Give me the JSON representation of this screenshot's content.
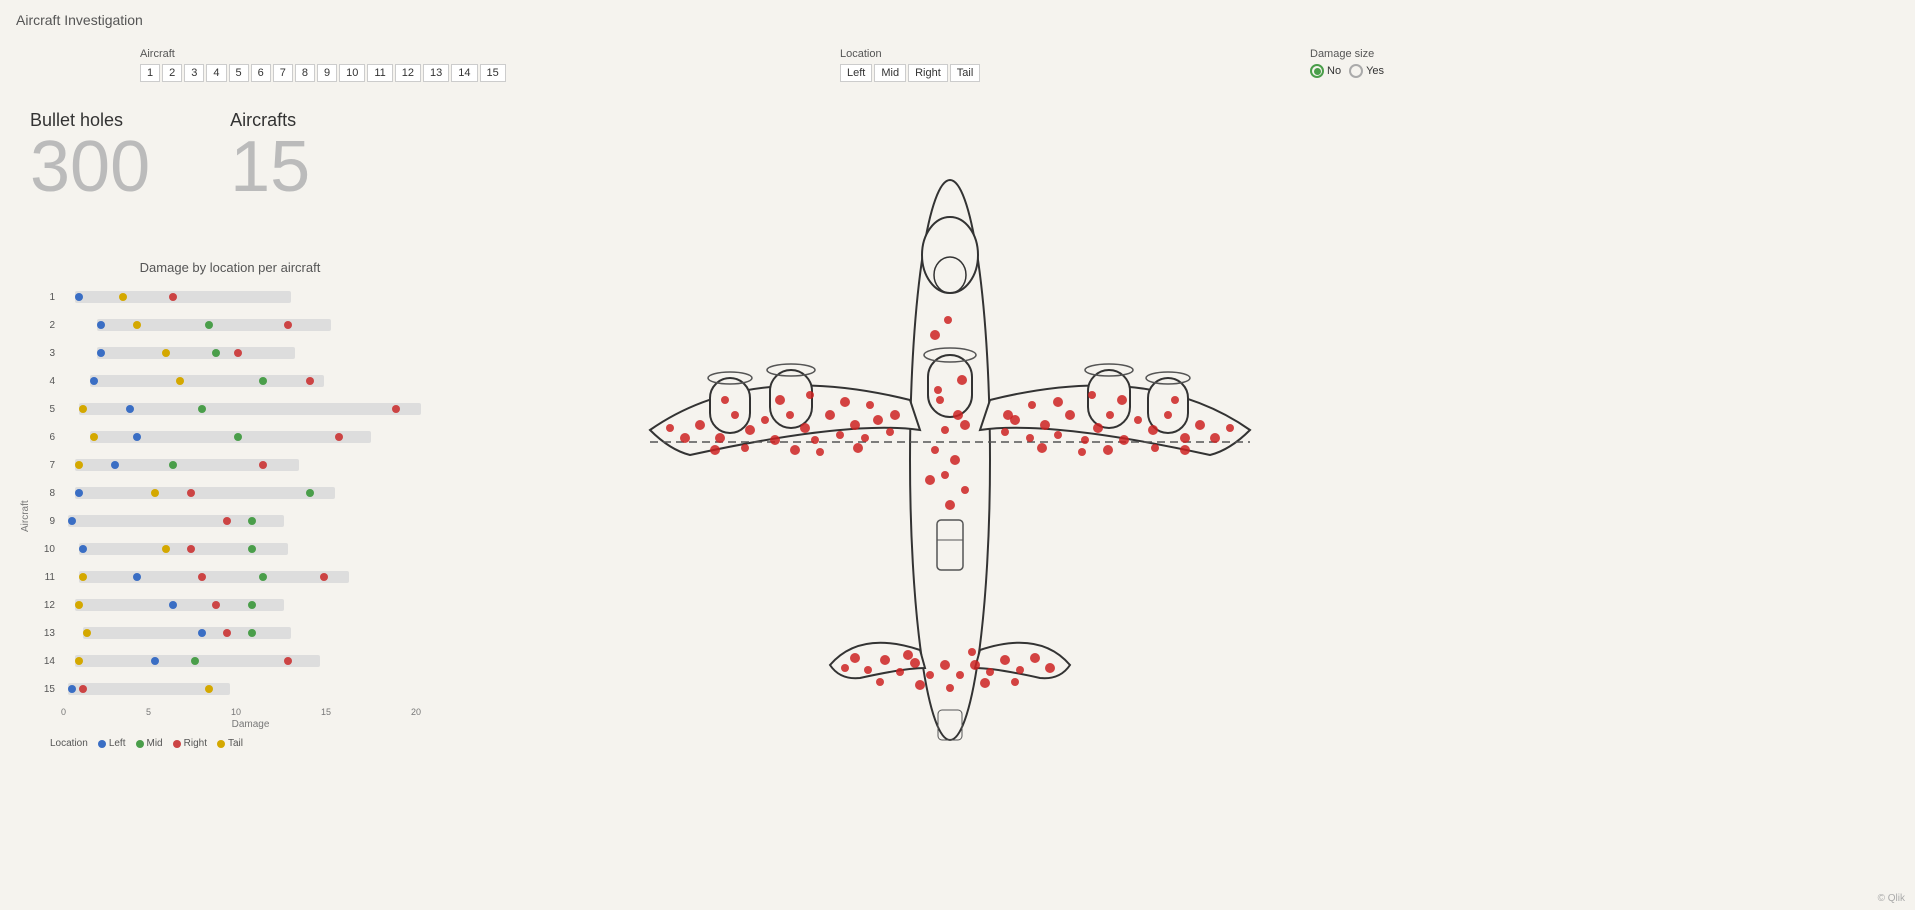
{
  "app": {
    "title": "Aircraft Investigation"
  },
  "aircraft_filter": {
    "label": "Aircraft",
    "buttons": [
      "1",
      "2",
      "3",
      "4",
      "5",
      "6",
      "7",
      "8",
      "9",
      "10",
      "11",
      "12",
      "13",
      "14",
      "15"
    ]
  },
  "location_filter": {
    "label": "Location",
    "buttons": [
      "Left",
      "Mid",
      "Right",
      "Tail"
    ]
  },
  "damage_size_filter": {
    "label": "Damage size",
    "options": [
      {
        "label": "No",
        "selected": true
      },
      {
        "label": "Yes",
        "selected": false
      }
    ]
  },
  "kpis": {
    "bullet_holes": {
      "label": "Bullet holes",
      "value": "300"
    },
    "aircrafts": {
      "label": "Aircrafts",
      "value": "15"
    }
  },
  "chart": {
    "title": "Damage by location per aircraft",
    "y_axis_label": "Aircraft",
    "x_axis_label": "Damage",
    "x_ticks": [
      "0",
      "5",
      "10",
      "15",
      "20"
    ],
    "rows": [
      {
        "id": "1",
        "bars": [
          {
            "left_pct": 4,
            "width_pct": 60
          }
        ],
        "dots": [
          {
            "color": "#3a6ec4",
            "pct": 4
          },
          {
            "color": "#d4a800",
            "pct": 16
          },
          {
            "color": "#cc4444",
            "pct": 30
          }
        ]
      },
      {
        "id": "2",
        "bars": [
          {
            "left_pct": 10,
            "width_pct": 65
          }
        ],
        "dots": [
          {
            "color": "#3a6ec4",
            "pct": 10
          },
          {
            "color": "#4a9e4a",
            "pct": 40
          },
          {
            "color": "#d4a800",
            "pct": 20
          },
          {
            "color": "#cc4444",
            "pct": 62
          }
        ]
      },
      {
        "id": "3",
        "bars": [
          {
            "left_pct": 10,
            "width_pct": 55
          }
        ],
        "dots": [
          {
            "color": "#3a6ec4",
            "pct": 10
          },
          {
            "color": "#4a9e4a",
            "pct": 42
          },
          {
            "color": "#d4a800",
            "pct": 28
          },
          {
            "color": "#cc4444",
            "pct": 48
          }
        ]
      },
      {
        "id": "4",
        "bars": [
          {
            "left_pct": 8,
            "width_pct": 65
          }
        ],
        "dots": [
          {
            "color": "#3a6ec4",
            "pct": 8
          },
          {
            "color": "#d4a800",
            "pct": 32
          },
          {
            "color": "#4a9e4a",
            "pct": 55
          },
          {
            "color": "#cc4444",
            "pct": 68
          }
        ]
      },
      {
        "id": "5",
        "bars": [
          {
            "left_pct": 5,
            "width_pct": 95
          }
        ],
        "dots": [
          {
            "color": "#d4a800",
            "pct": 5
          },
          {
            "color": "#3a6ec4",
            "pct": 18
          },
          {
            "color": "#4a9e4a",
            "pct": 38
          },
          {
            "color": "#cc4444",
            "pct": 92
          }
        ]
      },
      {
        "id": "6",
        "bars": [
          {
            "left_pct": 8,
            "width_pct": 78
          }
        ],
        "dots": [
          {
            "color": "#d4a800",
            "pct": 8
          },
          {
            "color": "#3a6ec4",
            "pct": 20
          },
          {
            "color": "#4a9e4a",
            "pct": 48
          },
          {
            "color": "#cc4444",
            "pct": 76
          }
        ]
      },
      {
        "id": "7",
        "bars": [
          {
            "left_pct": 4,
            "width_pct": 62
          }
        ],
        "dots": [
          {
            "color": "#d4a800",
            "pct": 4
          },
          {
            "color": "#3a6ec4",
            "pct": 14
          },
          {
            "color": "#4a9e4a",
            "pct": 30
          },
          {
            "color": "#cc4444",
            "pct": 55
          }
        ]
      },
      {
        "id": "8",
        "bars": [
          {
            "left_pct": 4,
            "width_pct": 72
          }
        ],
        "dots": [
          {
            "color": "#3a6ec4",
            "pct": 4
          },
          {
            "color": "#d4a800",
            "pct": 25
          },
          {
            "color": "#cc4444",
            "pct": 35
          },
          {
            "color": "#4a9e4a",
            "pct": 68
          }
        ]
      },
      {
        "id": "9",
        "bars": [
          {
            "left_pct": 2,
            "width_pct": 60
          }
        ],
        "dots": [
          {
            "color": "#3a6ec4",
            "pct": 2
          },
          {
            "color": "#cc4444",
            "pct": 45
          },
          {
            "color": "#4a9e4a",
            "pct": 52
          }
        ]
      },
      {
        "id": "10",
        "bars": [
          {
            "left_pct": 5,
            "width_pct": 58
          }
        ],
        "dots": [
          {
            "color": "#3a6ec4",
            "pct": 5
          },
          {
            "color": "#d4a800",
            "pct": 28
          },
          {
            "color": "#cc4444",
            "pct": 35
          },
          {
            "color": "#4a9e4a",
            "pct": 52
          }
        ]
      },
      {
        "id": "11",
        "bars": [
          {
            "left_pct": 5,
            "width_pct": 75
          }
        ],
        "dots": [
          {
            "color": "#d4a800",
            "pct": 5
          },
          {
            "color": "#3a6ec4",
            "pct": 20
          },
          {
            "color": "#cc4444",
            "pct": 38
          },
          {
            "color": "#4a9e4a",
            "pct": 55
          },
          {
            "color": "#cc4444",
            "pct": 72
          }
        ]
      },
      {
        "id": "12",
        "bars": [
          {
            "left_pct": 4,
            "width_pct": 58
          }
        ],
        "dots": [
          {
            "color": "#d4a800",
            "pct": 4
          },
          {
            "color": "#3a6ec4",
            "pct": 30
          },
          {
            "color": "#cc4444",
            "pct": 42
          },
          {
            "color": "#4a9e4a",
            "pct": 52
          }
        ]
      },
      {
        "id": "13",
        "bars": [
          {
            "left_pct": 6,
            "width_pct": 58
          }
        ],
        "dots": [
          {
            "color": "#d4a800",
            "pct": 6
          },
          {
            "color": "#3a6ec4",
            "pct": 38
          },
          {
            "color": "#cc4444",
            "pct": 45
          },
          {
            "color": "#4a9e4a",
            "pct": 52
          }
        ]
      },
      {
        "id": "14",
        "bars": [
          {
            "left_pct": 4,
            "width_pct": 68
          }
        ],
        "dots": [
          {
            "color": "#d4a800",
            "pct": 4
          },
          {
            "color": "#3a6ec4",
            "pct": 25
          },
          {
            "color": "#4a9e4a",
            "pct": 36
          },
          {
            "color": "#cc4444",
            "pct": 62
          }
        ]
      },
      {
        "id": "15",
        "bars": [
          {
            "left_pct": 2,
            "width_pct": 45
          }
        ],
        "dots": [
          {
            "color": "#3a6ec4",
            "pct": 2
          },
          {
            "color": "#cc4444",
            "pct": 5
          },
          {
            "color": "#d4a800",
            "pct": 40
          }
        ]
      }
    ]
  },
  "legend": {
    "label": "Location",
    "items": [
      {
        "label": "Left",
        "color": "#3a6ec4"
      },
      {
        "label": "Mid",
        "color": "#4a9e4a"
      },
      {
        "label": "Right",
        "color": "#cc4444"
      },
      {
        "label": "Tail",
        "color": "#d4a800"
      }
    ]
  },
  "aircraft_diagram": {
    "bullet_holes_count": 150
  },
  "qlik": {
    "watermark": "© Qlik"
  }
}
